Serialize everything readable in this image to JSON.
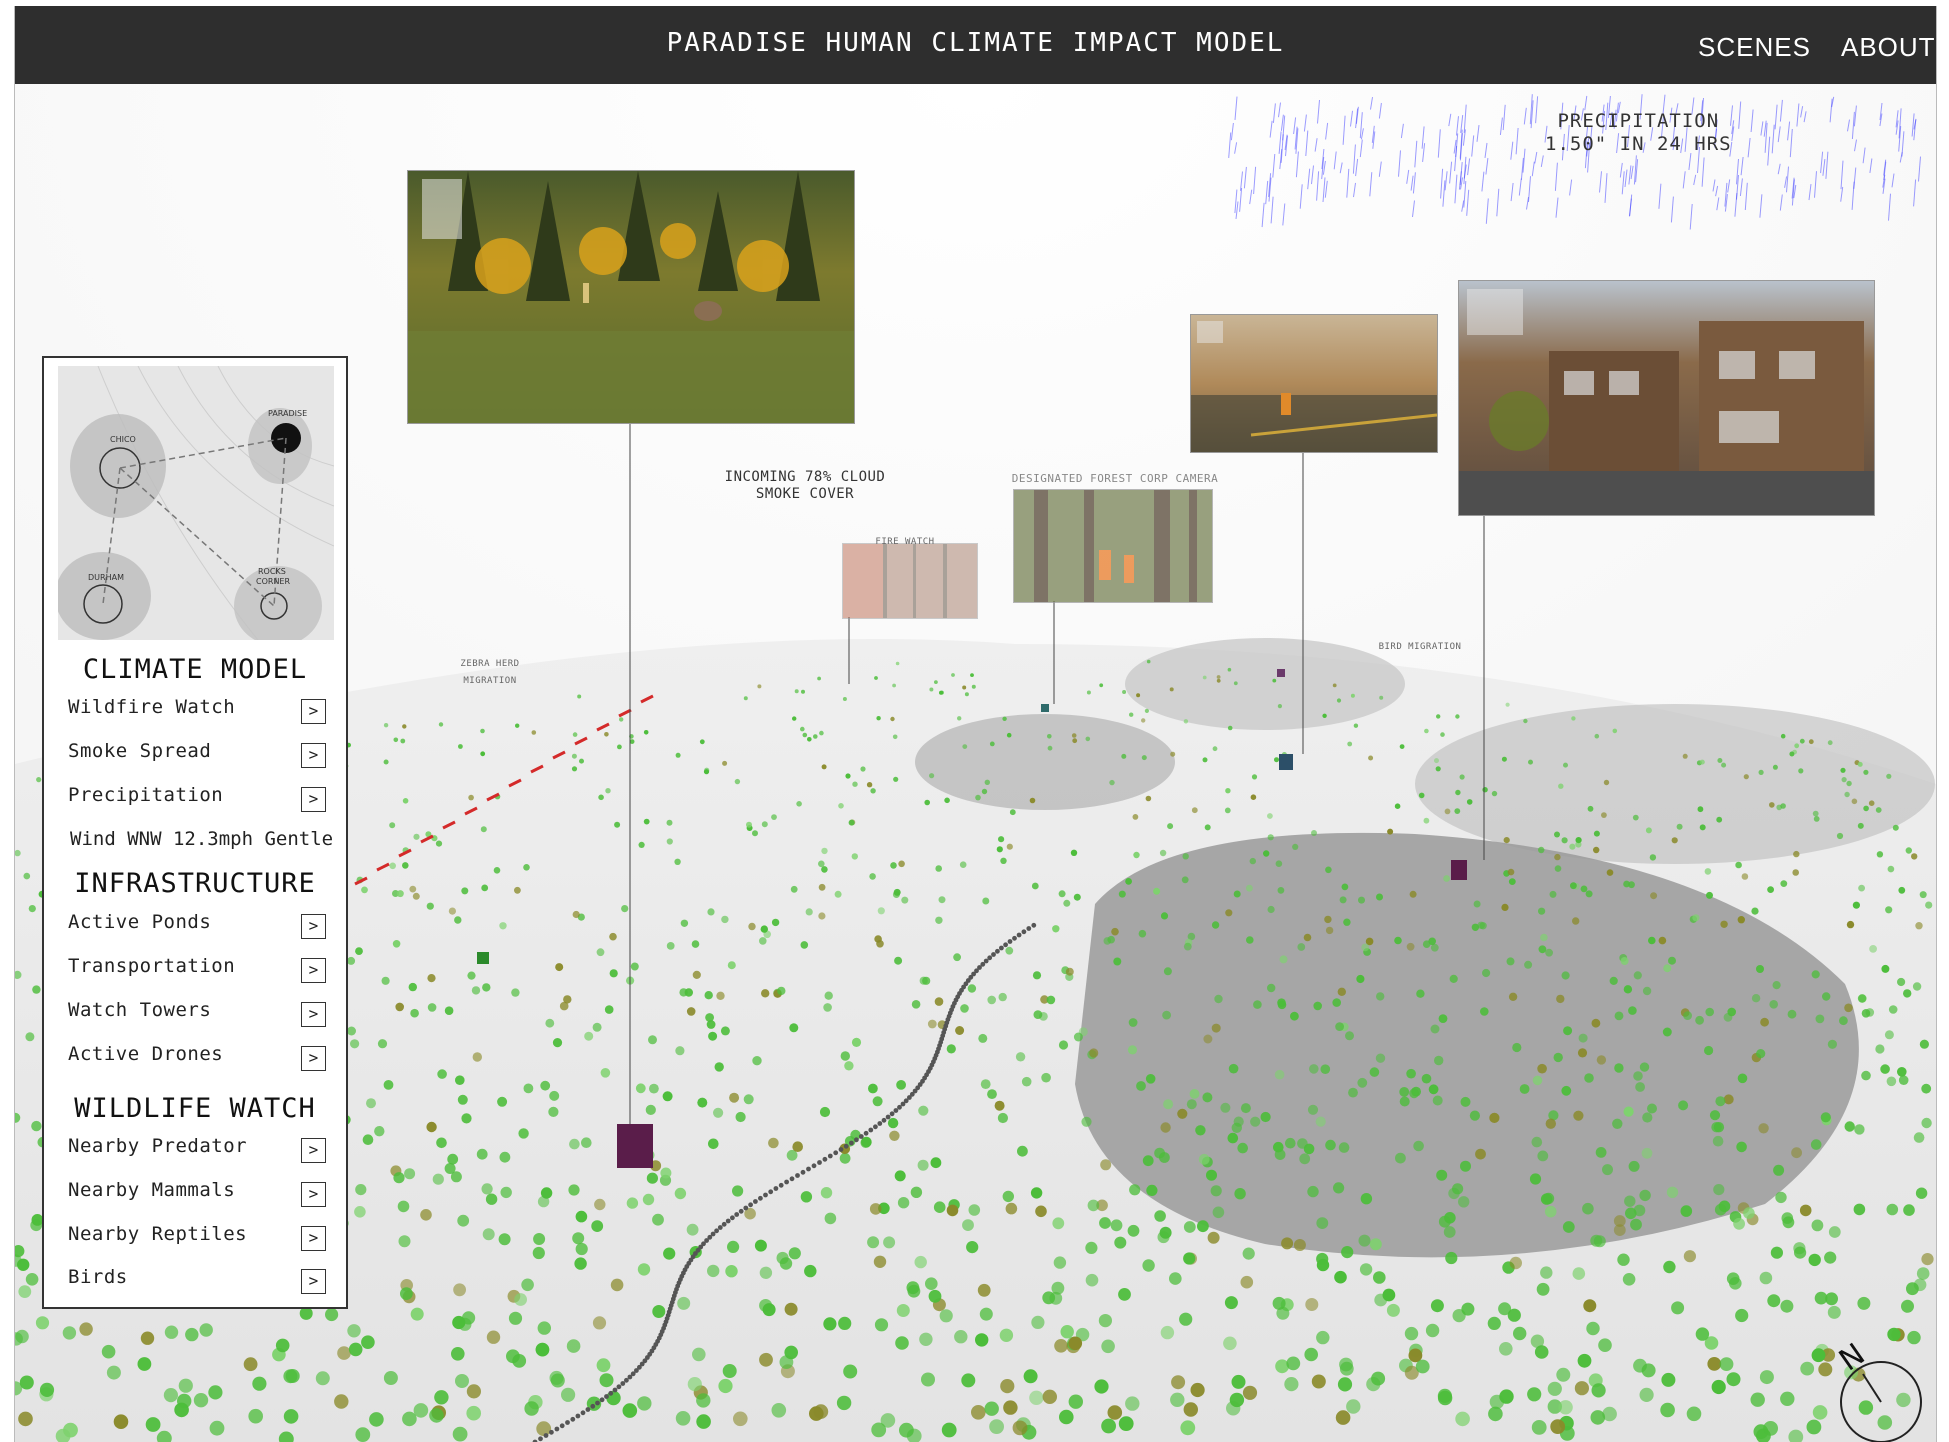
{
  "header": {
    "title": "PARADISE HUMAN CLIMATE IMPACT MODEL",
    "nav": [
      {
        "label": "SCENES"
      },
      {
        "label": "ABOUT"
      }
    ]
  },
  "precipitation": {
    "title": "PRECIPITATION",
    "value": "1.50\" IN 24 HRS"
  },
  "minimap": {
    "labels": [
      "CHICO",
      "PARADISE",
      "DURHAM",
      "ROCKS",
      "CORNER"
    ]
  },
  "panel": {
    "climate_model": {
      "title": "CLIMATE MODEL",
      "items": [
        "Wildfire Watch",
        "Smoke Spread",
        "Precipitation"
      ],
      "wind": "Wind WNW 12.3mph Gentle"
    },
    "infrastructure": {
      "title": "INFRASTRUCTURE",
      "items": [
        "Active Ponds",
        "Transportation",
        "Watch Towers",
        "Active Drones"
      ]
    },
    "wildlife_watch": {
      "title": "WILDLIFE WATCH",
      "items": [
        "Nearby Predator",
        "Nearby Mammals",
        "Nearby Reptiles",
        "Birds"
      ]
    },
    "button_glyph": ">"
  },
  "annotations": {
    "smoke_line1": "INCOMING 78% CLOUD",
    "smoke_line2": "SMOKE COVER",
    "forest_camera": "DESIGNATED FOREST CORP CAMERA",
    "fire_watch": "FIRE WATCH",
    "zebra_line1": "ZEBRA HERD",
    "zebra_line2": "MIGRATION",
    "bird_migration": "BIRD MIGRATION"
  },
  "compass": {
    "label": "N"
  },
  "colors": {
    "header_bg": "#2e2e2e",
    "vegetation": "#4cbd3a",
    "olive": "#8a8a2a",
    "urban": "#8f8f8f",
    "marker": "#5a1d4a",
    "fire": "#d42a2a",
    "rain": "#3b3bff"
  }
}
